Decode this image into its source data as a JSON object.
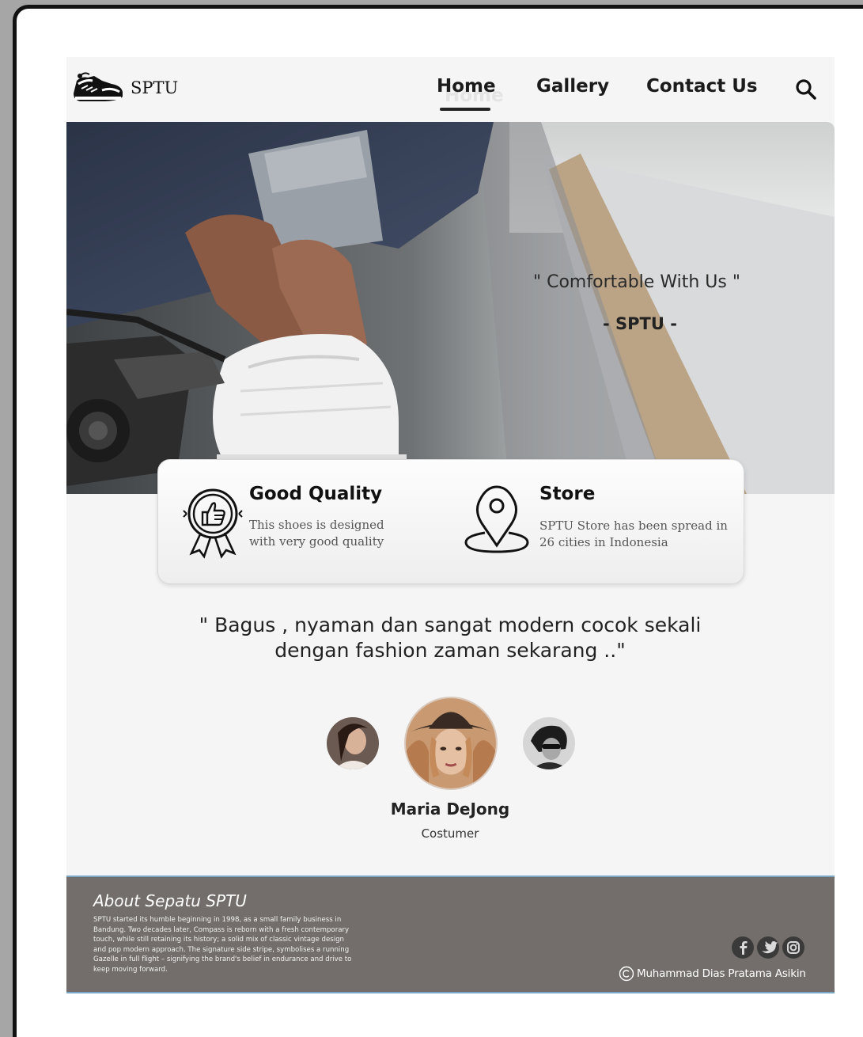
{
  "brand": {
    "logo_text": "SPTU"
  },
  "nav": {
    "home": "Home",
    "gallery": "Gallery",
    "contact": "Contact Us",
    "search_icon": "search-icon"
  },
  "hero": {
    "quote": "\" Comfortable With Us \"",
    "brand_line": "- SPTU -"
  },
  "features": {
    "quality": {
      "icon": "badge-thumbs-up-icon",
      "title": "Good Quality",
      "line1": "This shoes is designed",
      "line2": "with very good quality"
    },
    "store": {
      "icon": "location-pin-icon",
      "title": "Store",
      "line1": "SPTU Store has been spread in",
      "line2": "26 cities in Indonesia"
    }
  },
  "testimonial": {
    "line1": "\" Bagus , nyaman dan sangat modern cocok sekali",
    "line2": "dengan fashion zaman sekarang ..\"",
    "name": "Maria DeJong",
    "role": "Costumer"
  },
  "footer": {
    "title": "About Sepatu SPTU",
    "text": "SPTU started its humble beginning in 1998, as a small family business in Bandung. Two decades later, Compass is reborn with a fresh contemporary touch, while still retaining its history; a solid mix of classic vintage design and pop modern approach. The signature side stripe, symbolises a running Gazelle in full flight – signifying the brand's belief in endurance and drive to keep moving forward.",
    "social_icons": [
      "facebook-icon",
      "twitter-icon",
      "instagram-icon"
    ],
    "copyright": "Muhammad Dias Pratama Asikin"
  },
  "colors": {
    "page_bg": "#f5f5f5",
    "footer_bg": "#736e6b",
    "footer_border": "#7aa6c8",
    "text_dark": "#1b1b1b"
  }
}
